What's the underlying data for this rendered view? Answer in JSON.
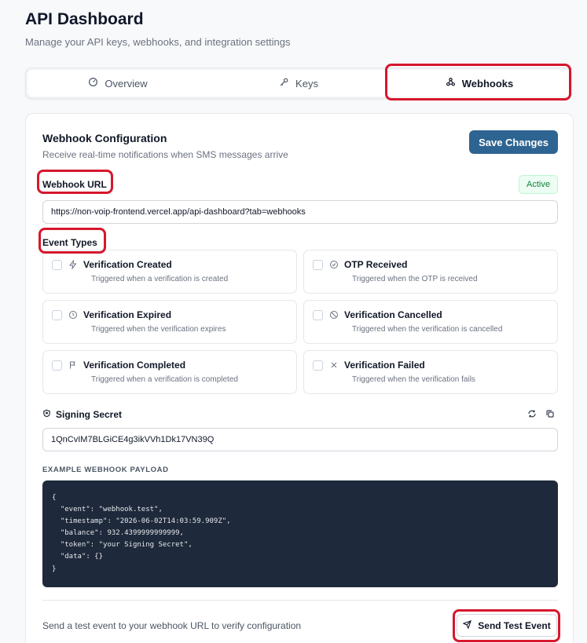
{
  "header": {
    "title": "API Dashboard",
    "subtitle": "Manage your API keys, webhooks, and integration settings"
  },
  "tabs": [
    {
      "label": "Overview",
      "icon": "gauge-icon"
    },
    {
      "label": "Keys",
      "icon": "key-icon"
    },
    {
      "label": "Webhooks",
      "icon": "webhook-icon",
      "active": true
    }
  ],
  "webhook": {
    "title": "Webhook Configuration",
    "description": "Receive real-time notifications when SMS messages arrive",
    "save_label": "Save Changes",
    "url_label": "Webhook URL",
    "status": "Active",
    "url_value": "https://non-voip-frontend.vercel.app/api-dashboard?tab=webhooks",
    "event_types_label": "Event Types",
    "events": [
      {
        "name": "Verification Created",
        "desc": "Triggered when a verification is created",
        "icon": "bolt-icon",
        "checked": false
      },
      {
        "name": "OTP Received",
        "desc": "Triggered when the OTP is received",
        "icon": "check-circle-icon",
        "checked": false
      },
      {
        "name": "Verification Expired",
        "desc": "Triggered when the verification expires",
        "icon": "clock-icon",
        "checked": false
      },
      {
        "name": "Verification Cancelled",
        "desc": "Triggered when the verification is cancelled",
        "icon": "ban-icon",
        "checked": false
      },
      {
        "name": "Verification Completed",
        "desc": "Triggered when a verification is completed",
        "icon": "flag-icon",
        "checked": false
      },
      {
        "name": "Verification Failed",
        "desc": "Triggered when the verification fails",
        "icon": "x-icon",
        "checked": false
      }
    ],
    "secret_label": "Signing Secret",
    "secret_value": "1QnCvIM7BLGiCE4g3ikVVh1Dk17VN39Q",
    "payload_label": "EXAMPLE WEBHOOK PAYLOAD",
    "payload": "{\n  \"event\": \"webhook.test\",\n  \"timestamp\": \"2026-06-02T14:03:59.909Z\",\n  \"balance\": 932.4399999999999,\n  \"token\": \"your Signing Secret\",\n  \"data\": {}\n}",
    "test_text": "Send a test event to your webhook URL to verify configuration",
    "test_label": "Send Test Event"
  },
  "colors": {
    "accent": "#2e6491",
    "highlight": "#d6172d",
    "code_bg": "#1e293b",
    "active_badge": "#15803d"
  }
}
